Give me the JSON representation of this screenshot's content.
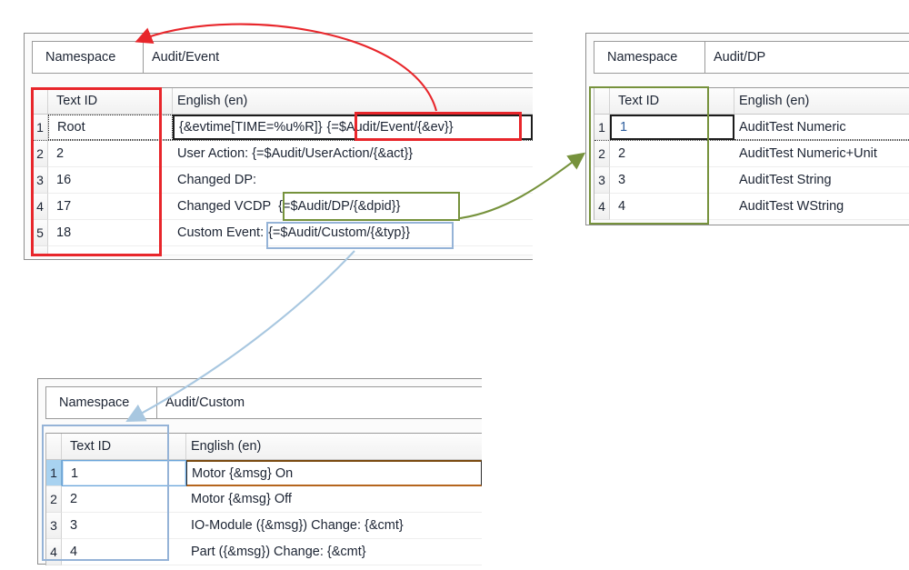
{
  "panels": [
    {
      "id": "audit-event",
      "namespace_label": "Namespace",
      "namespace_value": "Audit/Event",
      "columns": [
        "Text ID",
        "English (en)"
      ],
      "rows": [
        {
          "num": "1",
          "text_id": "Root",
          "english": "{&evtime[TIME=%u%R]} {=$Audit/Event/{&ev}}"
        },
        {
          "num": "2",
          "text_id": "2",
          "english": "User Action: {=$Audit/UserAction/{&act}}"
        },
        {
          "num": "3",
          "text_id": "16",
          "english": "Changed DP:"
        },
        {
          "num": "4",
          "text_id": "17",
          "english": "Changed VCDP {=$Audit/DP/{&dpid}}"
        },
        {
          "num": "5",
          "text_id": "18",
          "english": "Custom Event: {=$Audit/Custom/{&typ}}"
        }
      ],
      "row1_english_part_a": "{&evtime[TIME=%u%R]}",
      "row1_english_part_b": "{=$Audit/Event/{&ev}}",
      "row4_english_part_a": "Changed VCDP",
      "row4_english_part_b": "{=$Audit/DP/{&dpid}}",
      "row5_english_part_a": "Custom Event:",
      "row5_english_part_b": "{=$Audit/Custom/{&typ}}"
    },
    {
      "id": "audit-dp",
      "namespace_label": "Namespace",
      "namespace_value": "Audit/DP",
      "columns": [
        "Text ID",
        "English (en)"
      ],
      "rows": [
        {
          "num": "1",
          "text_id": "1",
          "english": "AuditTest Numeric"
        },
        {
          "num": "2",
          "text_id": "2",
          "english": "AuditTest Numeric+Unit"
        },
        {
          "num": "3",
          "text_id": "3",
          "english": "AuditTest String"
        },
        {
          "num": "4",
          "text_id": "4",
          "english": "AuditTest WString"
        }
      ]
    },
    {
      "id": "audit-custom",
      "namespace_label": "Namespace",
      "namespace_value": "Audit/Custom",
      "columns": [
        "Text ID",
        "English (en)"
      ],
      "rows": [
        {
          "num": "1",
          "text_id": "1",
          "english": "Motor {&msg} On"
        },
        {
          "num": "2",
          "text_id": "2",
          "english": "Motor {&msg} Off"
        },
        {
          "num": "3",
          "text_id": "3",
          "english": "IO-Module ({&msg}) Change: {&cmt}"
        },
        {
          "num": "4",
          "text_id": "4",
          "english": "Part ({&msg}) Change: {&cmt}"
        }
      ]
    }
  ],
  "annotation_colors": {
    "red": "#E8262B",
    "green": "#76923C",
    "blue": "#95B3D7"
  }
}
